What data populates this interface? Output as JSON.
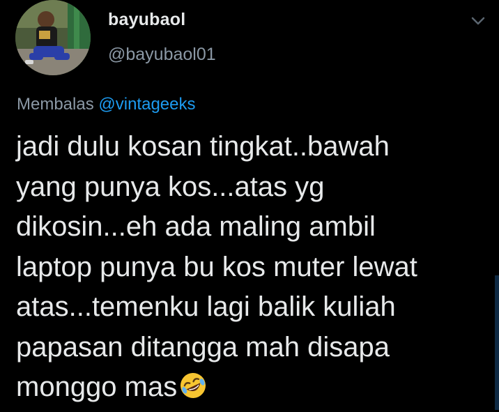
{
  "tweet": {
    "display_name": "bayubaol",
    "handle": "@bayubaol01",
    "reply_prefix": "Membalas",
    "reply_to": "@vintageeks",
    "lines": [
      "jadi dulu kosan tingkat..bawah",
      "yang punya kos...atas yg",
      "dikosin...eh ada maling ambil",
      "laptop punya bu kos muter lewat",
      "atas...temenku lagi balik kuliah",
      "papasan ditangga mah disapa",
      "monggo mas"
    ],
    "trailing_emoji": "rolling-on-the-floor-laughing-emoji"
  },
  "icons": {
    "avatar": "user-avatar-photo",
    "menu": "chevron-down-icon"
  },
  "colors": {
    "background": "#000000",
    "primary_text": "#e7e9ea",
    "secondary_text": "#8b98a5",
    "link": "#1d9bf0",
    "emoji_face": "#f7c531"
  }
}
